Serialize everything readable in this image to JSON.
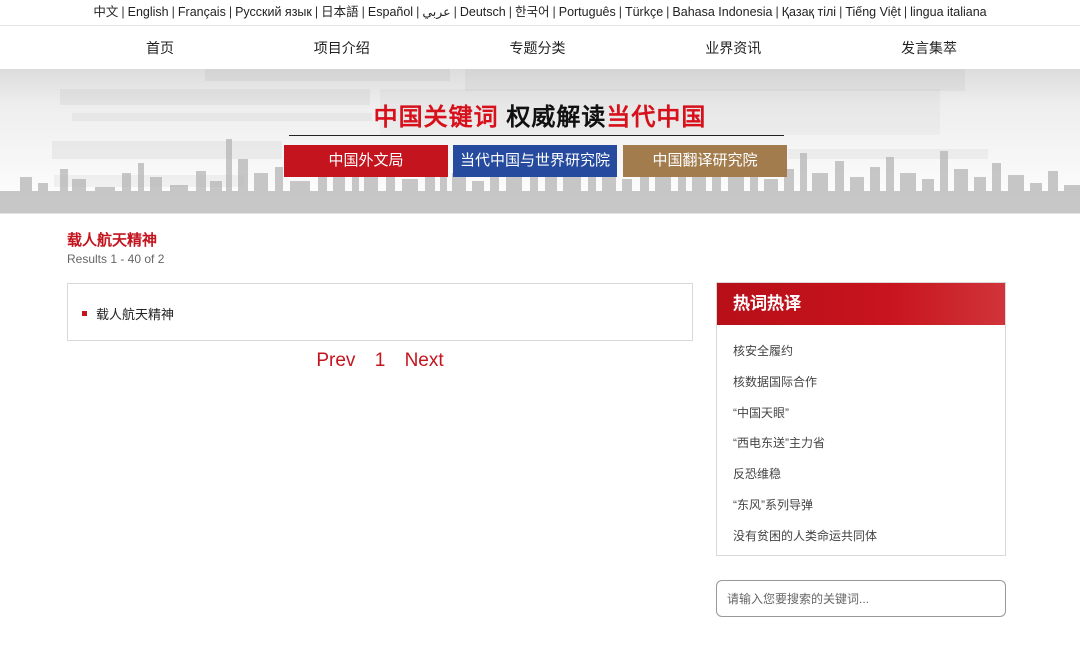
{
  "languages": [
    "中文",
    "English",
    "Français",
    "Русский язык",
    "日本語",
    "Español",
    "عربي",
    "Deutsch",
    "한국어",
    "Português",
    "Türkçe",
    "Bahasa Indonesia",
    "Қазақ тілі",
    "Tiếng Việt",
    "lingua italiana"
  ],
  "language_separator": "|",
  "nav": [
    "首页",
    "项目介绍",
    "专题分类",
    "业界资讯",
    "发言集萃"
  ],
  "banner": {
    "headline_red_1": "中国关键词",
    "headline_black": "权威解读",
    "headline_red_2": "当代中国",
    "orgs": [
      "中国外文局",
      "当代中国与世界研究院",
      "中国翻译研究院"
    ],
    "colors": {
      "red": "#c4141e",
      "blue": "#254a9e",
      "gold": "#a27c4d"
    }
  },
  "results": {
    "title": "载人航天精神",
    "count": "Results 1 - 40 of 2",
    "items": [
      "载人航天精神"
    ]
  },
  "pager": {
    "prev": "Prev",
    "page": "1",
    "next": "Next"
  },
  "sidebar": {
    "title": "热词热译",
    "items": [
      "核安全履约",
      "核数据国际合作",
      "“中国天眼”",
      "“西电东送”主力省",
      "反恐维稳",
      "“东风”系列导弹",
      "没有贫困的人类命运共同体"
    ]
  },
  "search": {
    "placeholder": "请输入您要搜索的关键词..."
  }
}
